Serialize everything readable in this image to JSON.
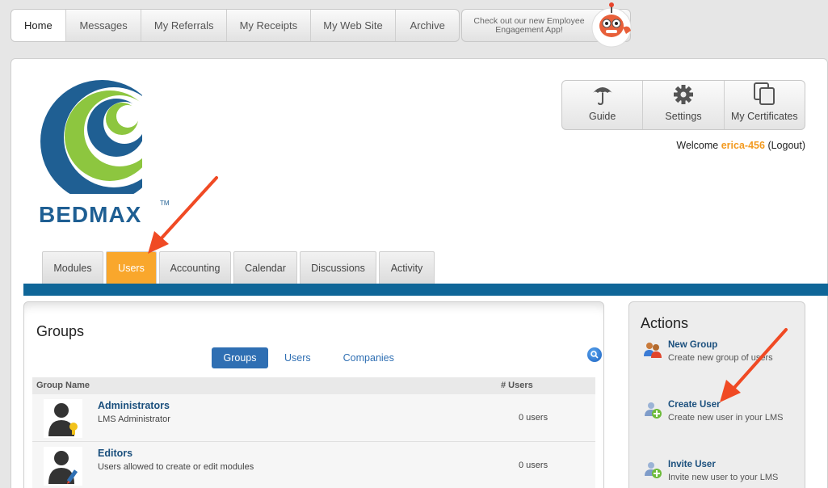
{
  "topnav": {
    "tabs": [
      "Home",
      "Messages",
      "My Referrals",
      "My Receipts",
      "My Web Site",
      "Archive"
    ],
    "promo": "Check out our new Employee Engagement App!"
  },
  "logo": {
    "text": "BEDMAX",
    "tm": "TM"
  },
  "toolbar": {
    "guide": "Guide",
    "settings": "Settings",
    "certificates": "My Certificates"
  },
  "welcome": {
    "prefix": "Welcome",
    "user": "erica-456",
    "logout": "(Logout)"
  },
  "apptabs": [
    "Modules",
    "Users",
    "Accounting",
    "Calendar",
    "Discussions",
    "Activity"
  ],
  "groups": {
    "title": "Groups",
    "segments": [
      "Groups",
      "Users",
      "Companies"
    ],
    "columns": {
      "name": "Group Name",
      "users": "# Users"
    },
    "rows": [
      {
        "name": "Administrators",
        "desc": "LMS Administrator",
        "count": "0 users"
      },
      {
        "name": "Editors",
        "desc": "Users allowed to create or edit modules",
        "count": "0 users"
      }
    ]
  },
  "actions": {
    "title": "Actions",
    "items": [
      {
        "label": "New Group",
        "desc": "Create new group of users"
      },
      {
        "label": "Create User",
        "desc": "Create new user in your LMS"
      },
      {
        "label": "Invite User",
        "desc": "Invite new user to your LMS"
      }
    ]
  },
  "colors": {
    "accent": "#f9a72c",
    "brand_blue": "#0f6698",
    "link": "#1a4f7d",
    "arrow": "#f04a24"
  }
}
